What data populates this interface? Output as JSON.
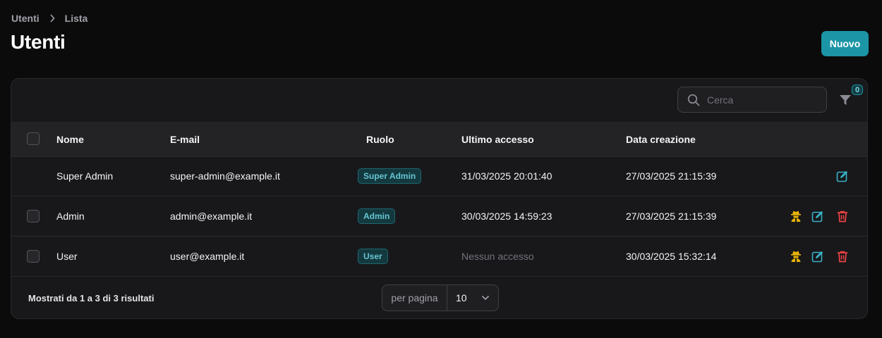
{
  "breadcrumb": {
    "items": [
      "Utenti",
      "Lista"
    ]
  },
  "page": {
    "title": "Utenti"
  },
  "actions": {
    "new_label": "Nuovo"
  },
  "search": {
    "placeholder": "Cerca",
    "value": ""
  },
  "filters": {
    "count": "0"
  },
  "table": {
    "headers": {
      "name": "Nome",
      "email": "E-mail",
      "role": "Ruolo",
      "last_access": "Ultimo accesso",
      "created": "Data creazione"
    },
    "rows": [
      {
        "name": "Super Admin",
        "email": "super-admin@example.it",
        "role": "Super Admin",
        "last_access": "31/03/2025 20:01:40",
        "created": "27/03/2025 21:15:39"
      },
      {
        "name": "Admin",
        "email": "admin@example.it",
        "role": "Admin",
        "last_access": "30/03/2025 14:59:23",
        "created": "27/03/2025 21:15:39"
      },
      {
        "name": "User",
        "email": "user@example.it",
        "role": "User",
        "last_access": "Nessun accesso",
        "created": "30/03/2025 15:32:14"
      }
    ]
  },
  "pagination": {
    "summary": "Mostrati da 1 a 3 di 3 risultati",
    "per_page_label": "per pagina",
    "per_page_value": "10"
  },
  "colors": {
    "accent": "#1c95a6",
    "impersonate": "#eab308",
    "edit": "#38b2c8",
    "delete": "#ef4444"
  },
  "icons": {
    "breadcrumb_separator": "chevron-right-icon",
    "search": "search-icon",
    "filter": "funnel-icon",
    "impersonate": "user-secret-icon",
    "edit": "pencil-square-icon",
    "delete": "trash-icon",
    "select": "chevron-down-icon"
  }
}
